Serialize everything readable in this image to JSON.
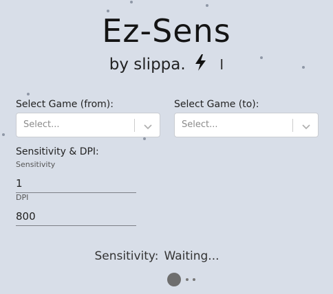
{
  "header": {
    "title": "Ez-Sens",
    "subtitle": "by slippa.",
    "cursor": "I"
  },
  "form": {
    "game_from": {
      "label": "Select Game (from):",
      "placeholder": "Select..."
    },
    "game_to": {
      "label": "Select Game (to):",
      "placeholder": "Select..."
    },
    "sens_dpi_section": "Sensitivity & DPI:",
    "sensitivity": {
      "label": "Sensitivity",
      "value": "1"
    },
    "dpi": {
      "label": "DPI",
      "value": "800"
    }
  },
  "result": {
    "label": "Sensitivity:",
    "value": "Waiting..."
  },
  "icons": {
    "lightning": "lightning-bolt-icon",
    "dropdown": "chevron-down-icon"
  },
  "colors": {
    "background": "#d8dee8",
    "text": "#1f1f1f",
    "placeholder": "#8a8a8a"
  }
}
